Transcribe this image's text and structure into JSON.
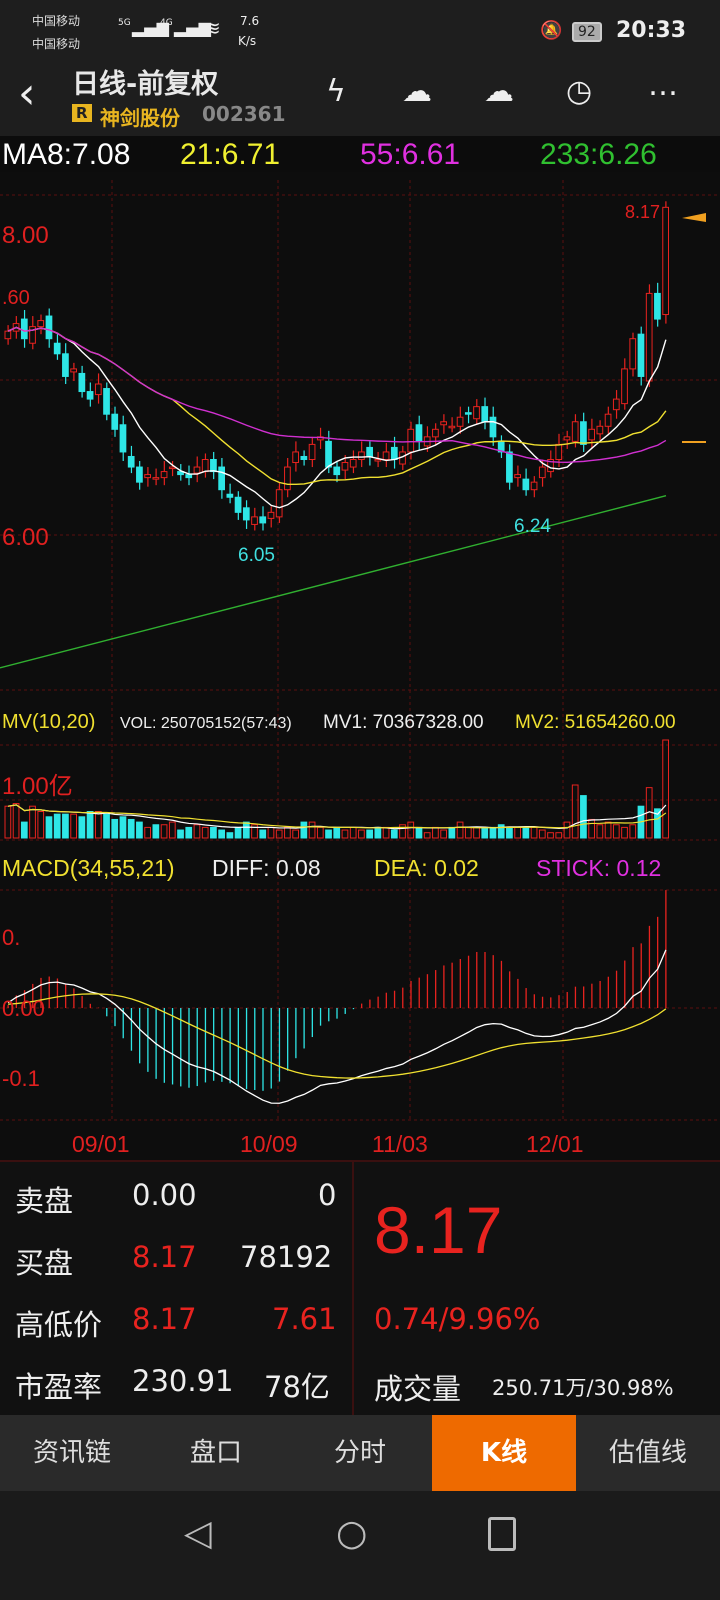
{
  "status": {
    "carrier1": "中国移动",
    "carrier2": "中国移动",
    "net1": "5G",
    "net2": "4G",
    "speed_value": "7.6",
    "speed_unit": "K/s",
    "battery": "92",
    "time": "20:33"
  },
  "header": {
    "title": "日线-前复权",
    "badge": "R",
    "stock_name": "神剑股份",
    "stock_code": "002361"
  },
  "ma": {
    "ma8": "MA8:7.08",
    "ma21": "21:6.71",
    "ma55": "55:6.61",
    "ma233": "233:6.26"
  },
  "price_labels": {
    "high_axis": "8.00",
    "low_axis": "6.00",
    "partial": ".60",
    "last": "8.17",
    "min1": "6.05",
    "min2": "6.24"
  },
  "vol": {
    "title": "MV(10,20)",
    "vol": "VOL: 250705152(57:43)",
    "mv1": "MV1: 70367328.00",
    "mv2": "MV2: 51654260.00",
    "axis": "1.00亿"
  },
  "macd": {
    "title": "MACD(34,55,21)",
    "diff": "DIFF: 0.08",
    "dea": "DEA: 0.02",
    "stick": "STICK: 0.12",
    "axis_top": "0.",
    "axis_zero": "0.00",
    "axis_neg": "-0.1"
  },
  "dates": [
    "09/01",
    "10/09",
    "11/03",
    "12/01"
  ],
  "quote": {
    "sell_label": "卖盘",
    "sell_price": "0.00",
    "sell_vol": "0",
    "buy_label": "买盘",
    "buy_price": "8.17",
    "buy_vol": "78192",
    "hl_label": "高低价",
    "high": "8.17",
    "low": "7.61",
    "pe_label": "市盈率",
    "pe": "230.91",
    "cap": "78亿",
    "price": "8.17",
    "change": "0.74/9.96%",
    "volume_label": "成交量",
    "volume": "250.71万/30.98%"
  },
  "tabs": [
    "资讯链",
    "盘口",
    "分时",
    "K线",
    "估值线"
  ],
  "colors": {
    "up": "#e8231f",
    "down": "#2ee6e6",
    "ma8": "#ffffff",
    "ma21": "#f0e030",
    "ma55": "#d030d0",
    "ma233": "#30b030",
    "accent": "#ee6a00"
  },
  "chart_data": {
    "type": "candlestick",
    "y_range": [
      5.0,
      8.3
    ],
    "closes": [
      7.35,
      7.4,
      7.3,
      7.38,
      7.42,
      7.3,
      7.2,
      7.05,
      7.1,
      6.95,
      6.9,
      7.0,
      6.8,
      6.7,
      6.55,
      6.45,
      6.35,
      6.4,
      6.38,
      6.42,
      6.45,
      6.4,
      6.38,
      6.45,
      6.5,
      6.42,
      6.3,
      6.25,
      6.15,
      6.1,
      6.12,
      6.08,
      6.15,
      6.3,
      6.45,
      6.55,
      6.5,
      6.6,
      6.65,
      6.45,
      6.4,
      6.48,
      6.5,
      6.55,
      6.52,
      6.5,
      6.55,
      6.5,
      6.55,
      6.7,
      6.62,
      6.65,
      6.7,
      6.75,
      6.72,
      6.78,
      6.8,
      6.85,
      6.75,
      6.65,
      6.55,
      6.35,
      6.4,
      6.3,
      6.35,
      6.45,
      6.5,
      6.6,
      6.65,
      6.75,
      6.6,
      6.7,
      6.72,
      6.8,
      6.9,
      7.1,
      7.3,
      7.05,
      7.6,
      7.43,
      8.17
    ],
    "volumes_yi": [
      0.6,
      0.65,
      0.3,
      0.6,
      0.5,
      0.4,
      0.45,
      0.45,
      0.45,
      0.4,
      0.5,
      0.5,
      0.45,
      0.35,
      0.4,
      0.35,
      0.3,
      0.2,
      0.25,
      0.25,
      0.3,
      0.15,
      0.2,
      0.25,
      0.2,
      0.2,
      0.15,
      0.1,
      0.2,
      0.3,
      0.25,
      0.15,
      0.2,
      0.15,
      0.2,
      0.15,
      0.3,
      0.3,
      0.2,
      0.15,
      0.2,
      0.15,
      0.2,
      0.15,
      0.15,
      0.2,
      0.2,
      0.15,
      0.25,
      0.3,
      0.2,
      0.1,
      0.2,
      0.15,
      0.2,
      0.3,
      0.2,
      0.2,
      0.2,
      0.2,
      0.25,
      0.2,
      0.2,
      0.2,
      0.2,
      0.15,
      0.1,
      0.1,
      0.3,
      1.0,
      0.8,
      0.35,
      0.25,
      0.3,
      0.25,
      0.2,
      0.25,
      0.6,
      0.95,
      0.55,
      2.51
    ],
    "ma233_range": [
      5.12,
      6.26
    ],
    "macd_range": [
      -0.14,
      0.18
    ]
  }
}
